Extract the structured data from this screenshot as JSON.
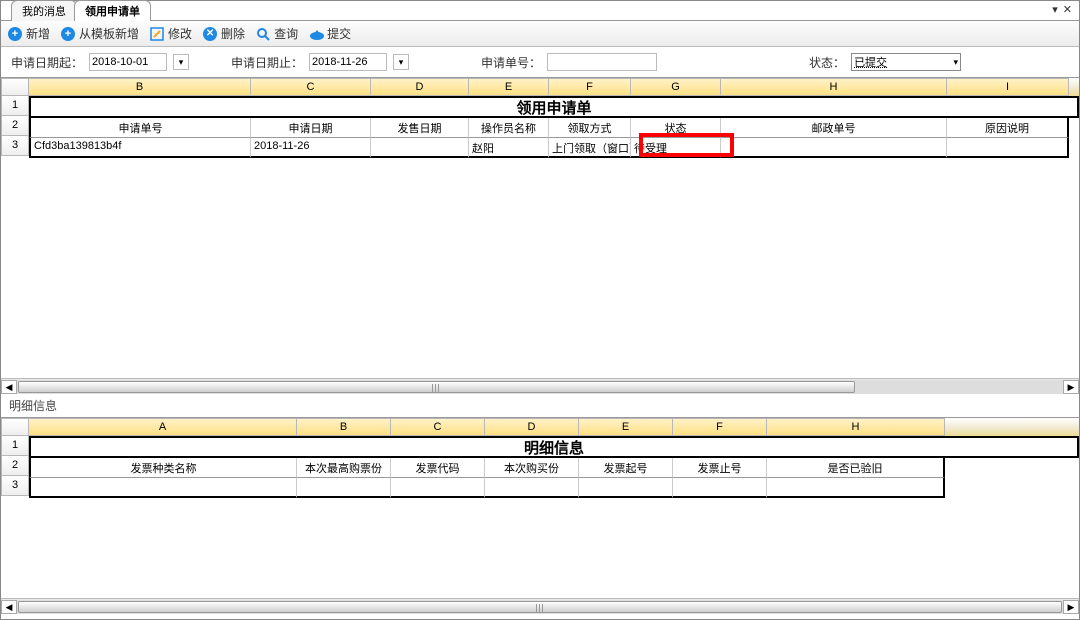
{
  "tabs": {
    "inactive": "我的消息",
    "active": "领用申请单"
  },
  "toolbar": {
    "add": "新增",
    "add_from_tpl": "从模板新增",
    "edit": "修改",
    "delete": "删除",
    "query": "查询",
    "submit": "提交"
  },
  "filter": {
    "date_from_label": "申请日期起：",
    "date_from": "2018-10-01",
    "date_to_label": "申请日期止：",
    "date_to": "2018-11-26",
    "order_label": "申请单号：",
    "order_value": "",
    "status_label": "状态：",
    "status_value": "已提交"
  },
  "top_grid": {
    "cols": [
      "B",
      "C",
      "D",
      "E",
      "F",
      "G",
      "H",
      "I"
    ],
    "title": "领用申请单",
    "headers": [
      "申请单号",
      "申请日期",
      "发售日期",
      "操作员名称",
      "领取方式",
      "状态",
      "邮政单号",
      "原因说明"
    ],
    "row": {
      "order_no": "Cfd3ba139813b4f",
      "apply_date": "2018-11-26",
      "sale_date": "",
      "operator": "赵阳",
      "pickup": "上门领取（窗口）",
      "status": "待受理",
      "post_no": "",
      "reason": ""
    }
  },
  "detail_label": "明细信息",
  "bottom_grid": {
    "cols": [
      "A",
      "B",
      "C",
      "D",
      "E",
      "F",
      "H"
    ],
    "title": "明细信息",
    "headers": [
      "发票种类名称",
      "本次最高购票份",
      "发票代码",
      "本次购买份",
      "发票起号",
      "发票止号",
      "是否已验旧"
    ]
  }
}
